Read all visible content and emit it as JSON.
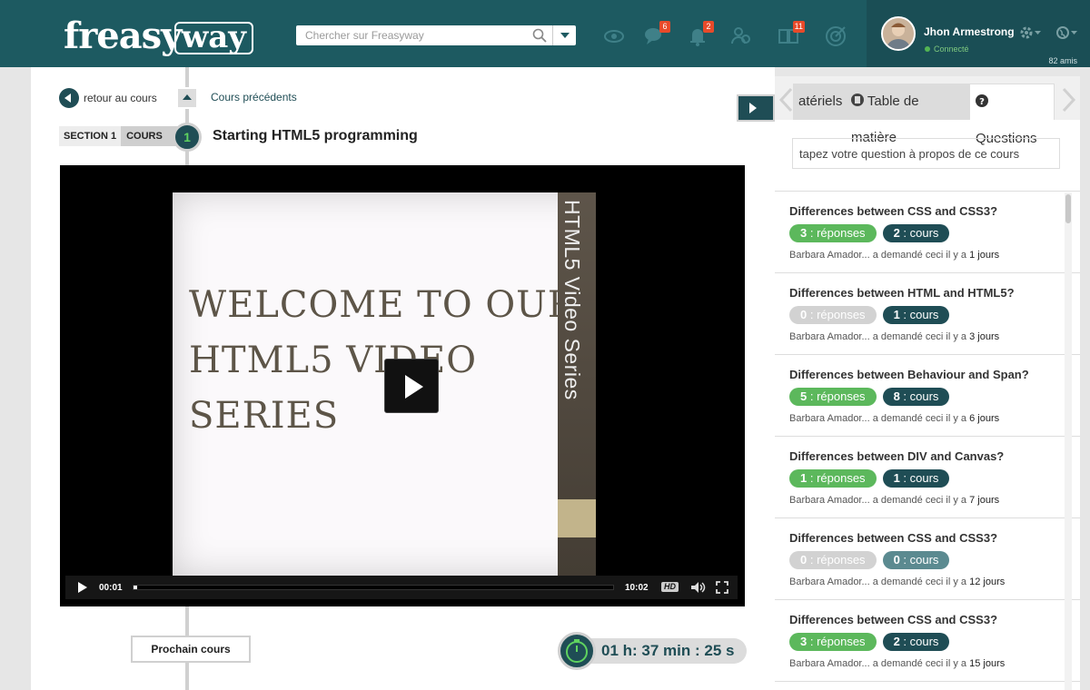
{
  "header": {
    "logo_part1": "freasy",
    "logo_part2": "way",
    "search_placeholder": "Chercher sur Freasyway",
    "badges": {
      "messages": "6",
      "notifications": "2",
      "library": "11"
    }
  },
  "user": {
    "name": "Jhon Armestrong",
    "status": "Connecté",
    "friends": "82 amis"
  },
  "course": {
    "back_label": "retour au cours",
    "prev_label": "Cours précédents",
    "section_label": "SECTION 1",
    "cours_label": "COURS",
    "number": "1",
    "title": "Starting HTML5 programming",
    "next_label": "Prochain cours",
    "timer": "01 h: 37 min : 25 s"
  },
  "video": {
    "slide_text_line1": "WELCOME TO OUR",
    "slide_text_line2": "HTML5 VIDEO",
    "slide_text_line3": "SERIES",
    "spine_text": "HTML5 Video Series",
    "current_time": "00:01",
    "duration": "10:02",
    "hd_label": "HD",
    "progress": 0.002
  },
  "panel": {
    "tabs": [
      "atériels",
      "Table de matière",
      "Questions"
    ],
    "question_placeholder": "tapez votre question à propos de ce cours",
    "questions": [
      {
        "title": "Differences between CSS and CSS3?",
        "answers": "3",
        "answers_label": " : réponses",
        "courses": "2",
        "courses_label": " : cours",
        "meta": "Barbara Amador... a demandé ceci il y a ",
        "days": "1 jours"
      },
      {
        "title": "Differences between HTML and HTML5?",
        "answers": "0",
        "answers_label": " : réponses",
        "courses": "1",
        "courses_label": " : cours",
        "meta": "Barbara Amador... a demandé ceci il y a ",
        "days": "3 jours"
      },
      {
        "title": "Differences between Behaviour and Span?",
        "answers": "5",
        "answers_label": " : réponses",
        "courses": "8",
        "courses_label": " : cours",
        "meta": "Barbara Amador... a demandé ceci il y a ",
        "days": "6 jours"
      },
      {
        "title": "Differences between DIV and Canvas?",
        "answers": "1",
        "answers_label": " : réponses",
        "courses": "1",
        "courses_label": " : cours",
        "meta": "Barbara Amador... a demandé ceci il y a ",
        "days": "7 jours"
      },
      {
        "title": "Differences between CSS and CSS3?",
        "answers": "0",
        "answers_label": " : réponses",
        "courses": "0",
        "courses_label": " : cours",
        "meta": "Barbara Amador... a demandé ceci il y a ",
        "days": "12 jours"
      },
      {
        "title": "Differences between CSS and CSS3?",
        "answers": "3",
        "answers_label": " : réponses",
        "courses": "2",
        "courses_label": " : cours",
        "meta": "Barbara Amador... a demandé ceci il y a ",
        "days": "15 jours"
      }
    ]
  },
  "colors": {
    "brand": "#1d5a61",
    "accent_green": "#5cb85c",
    "dark_teal": "#1f4d55",
    "badge_red": "#e84a2a"
  }
}
